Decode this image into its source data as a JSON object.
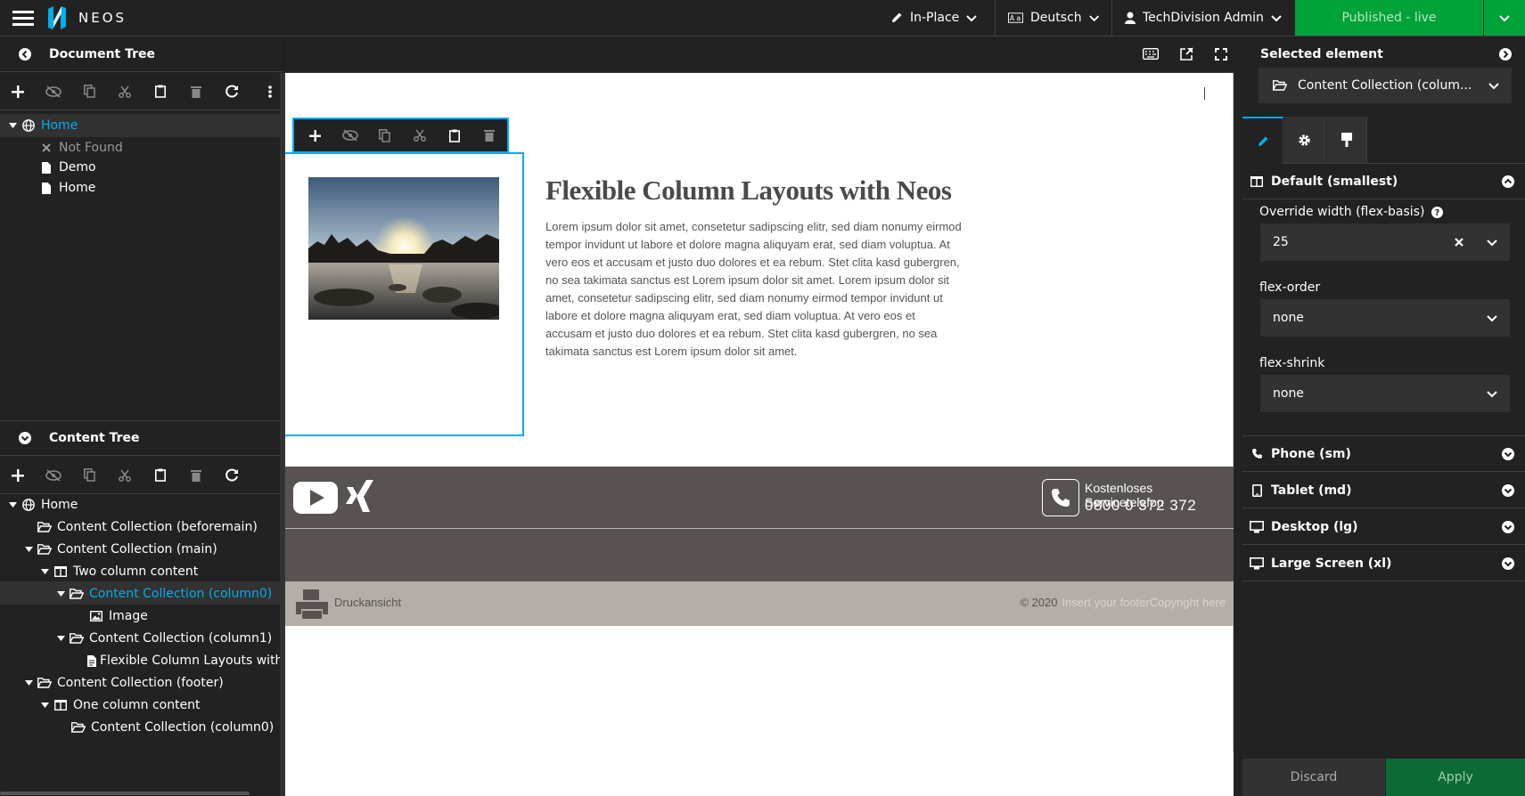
{
  "topbar": {
    "brand": "NEOS",
    "edit_mode": "In-Place",
    "language": "Deutsch",
    "user": "TechDivision Admin",
    "publish": "Published - live"
  },
  "document_tree": {
    "title": "Document Tree",
    "nodes": [
      "Home",
      "Not Found",
      "Demo",
      "Home"
    ]
  },
  "content_tree": {
    "title": "Content Tree",
    "nodes": [
      "Home",
      "Content Collection (beforemain)",
      "Content Collection (main)",
      "Two column content",
      "Content Collection (column0)",
      "Image",
      "Content Collection (column1)",
      "Flexible Column Layouts with",
      "Content Collection (footer)",
      "One column content",
      "Content Collection (column0)"
    ]
  },
  "page": {
    "heading": "Flexible Column Layouts with Neos",
    "body": "Lorem ipsum dolor sit amet, consetetur sadipscing elitr, sed diam nonumy eirmod tempor invidunt ut labore et dolore magna aliquyam erat, sed diam voluptua. At vero eos et accusam et justo duo dolores et ea rebum. Stet clita kasd gubergren, no sea takimata sanctus est Lorem ipsum dolor sit amet. Lorem ipsum dolor sit amet, consetetur sadipscing elitr, sed diam nonumy eirmod tempor invidunt ut labore et dolore magna aliquyam erat, sed diam voluptua. At vero eos et accusam et justo duo dolores et ea rebum. Stet clita kasd gubergren, no sea takimata sanctus est Lorem ipsum dolor sit amet.",
    "service_label": "Kostenloses Servicetelefon",
    "service_phone": "0800 0 372 372",
    "print_label": "Druckansicht",
    "copyright": "© 2020",
    "copyright_placeholder": "Insert your footerCopyright here"
  },
  "inspector": {
    "title": "Selected element",
    "selected": "Content Collection (colum...",
    "default_section": "Default (smallest)",
    "override_label": "Override width (flex-basis)",
    "override_value": "25",
    "flex_order_label": "flex-order",
    "flex_order_value": "none",
    "flex_shrink_label": "flex-shrink",
    "flex_shrink_value": "none",
    "sections": [
      "Phone (sm)",
      "Tablet (md)",
      "Desktop (lg)",
      "Large Screen (xl)"
    ],
    "discard": "Discard",
    "apply": "Apply"
  },
  "colors": {
    "accent": "#00adee",
    "publish_green": "#00a338",
    "apply_green": "#0c6b35",
    "panel": "#222222",
    "footer_dark": "#585350",
    "footer_light": "#b5aea8"
  }
}
